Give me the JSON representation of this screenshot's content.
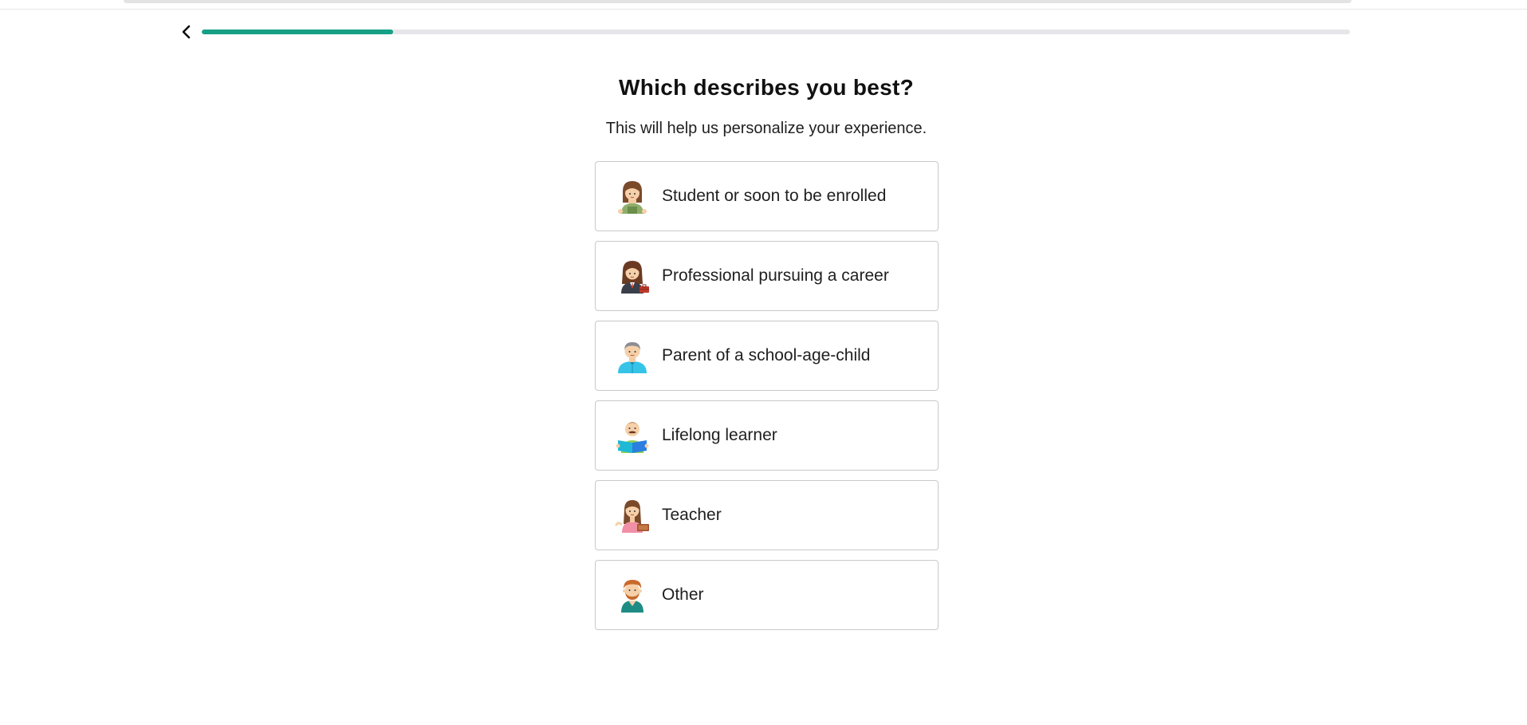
{
  "header": {
    "back_icon": "chevron-left-icon",
    "progress_fraction": 0.167,
    "progress_color": "#16a085",
    "track_color": "#e6e6ea"
  },
  "main": {
    "title": "Which describes you best?",
    "subtitle": "This will help us personalize your experience.",
    "options": [
      {
        "label": "Student or soon to be enrolled",
        "icon": "student-avatar-icon"
      },
      {
        "label": "Professional pursuing a career",
        "icon": "professional-avatar-icon"
      },
      {
        "label": "Parent of a school-age-child",
        "icon": "parent-avatar-icon"
      },
      {
        "label": "Lifelong learner",
        "icon": "lifelong-learner-avatar-icon"
      },
      {
        "label": "Teacher",
        "icon": "teacher-avatar-icon"
      },
      {
        "label": "Other",
        "icon": "other-avatar-icon"
      }
    ]
  }
}
